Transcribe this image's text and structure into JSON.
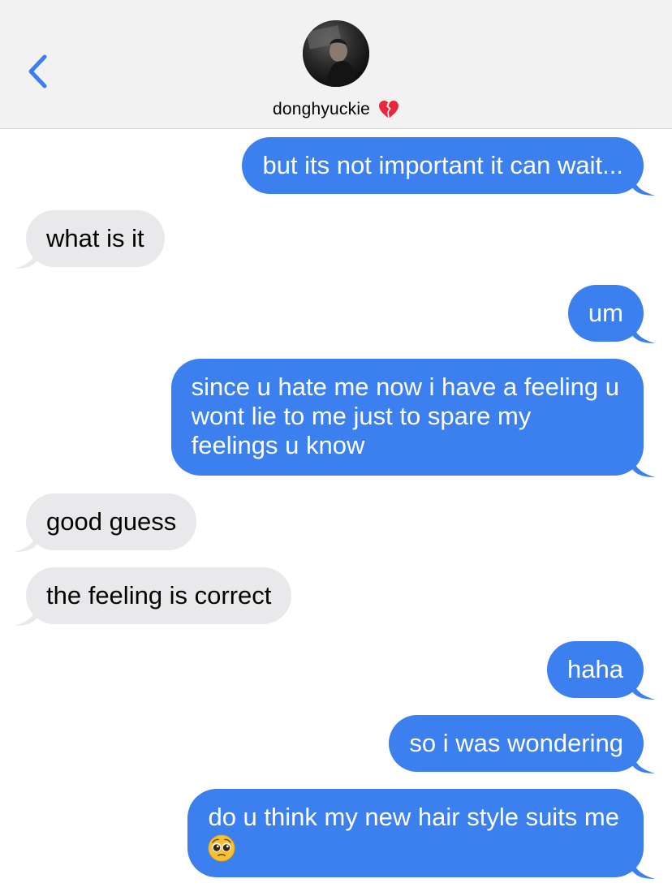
{
  "header": {
    "contact_name": "donghyuckie",
    "name_emoji": "broken-heart-icon",
    "back_icon": "chevron-left-icon",
    "accent_color": "#3b80ee"
  },
  "messages": [
    {
      "direction": "sent",
      "text": "but its not important it can wait..."
    },
    {
      "direction": "received",
      "text": "what is it"
    },
    {
      "direction": "sent",
      "text": "um"
    },
    {
      "direction": "sent",
      "lines": [
        "since u hate me now i have a feeling u",
        "wont lie to me just to spare my",
        "feelings u know"
      ]
    },
    {
      "direction": "received",
      "text": "good guess"
    },
    {
      "direction": "received",
      "text": "the feeling is correct"
    },
    {
      "direction": "sent",
      "text": "haha"
    },
    {
      "direction": "sent",
      "text": "so i was wondering"
    },
    {
      "direction": "sent",
      "text": "do u think my new hair style suits me",
      "emoji": "pleading-face-icon"
    }
  ],
  "colors": {
    "sent_bubble": "#3b80ee",
    "received_bubble": "#e9e9eb",
    "header_bg": "#f2f2f2"
  }
}
